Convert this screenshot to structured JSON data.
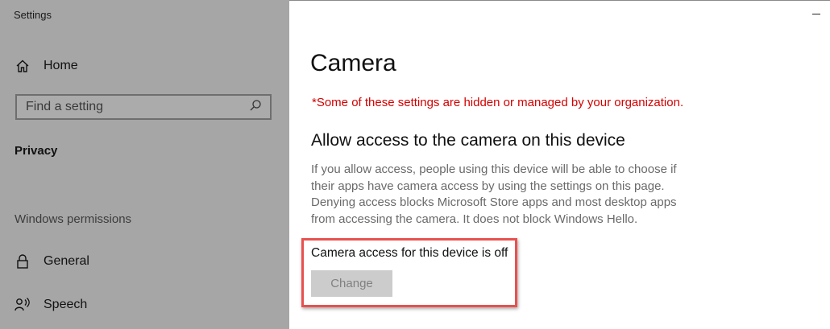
{
  "app": {
    "title": "Settings"
  },
  "sidebar": {
    "home": {
      "label": "Home",
      "icon": "home-icon"
    },
    "search": {
      "placeholder": "Find a setting",
      "icon": "search-icon"
    },
    "current_section": "Privacy",
    "group_label": "Windows permissions",
    "items": [
      {
        "label": "General",
        "icon": "lock-icon"
      },
      {
        "label": "Speech",
        "icon": "speech-icon"
      }
    ]
  },
  "main": {
    "title": "Camera",
    "managed_notice": "*Some of these settings are hidden or managed by your organization.",
    "section_heading": "Allow access to the camera on this device",
    "description": "If you allow access, people using this device will be able to choose if their apps have camera access by using the settings on this page. Denying access blocks Microsoft Store apps and most desktop apps from accessing the camera. It does not block Windows Hello.",
    "status_text": "Camera access for this device is off",
    "change_button": "Change"
  },
  "colors": {
    "sidebar_bg": "#a6a6a6",
    "warning": "#d40000",
    "highlight": "#e8514f",
    "button_disabled_bg": "#cccccc"
  }
}
